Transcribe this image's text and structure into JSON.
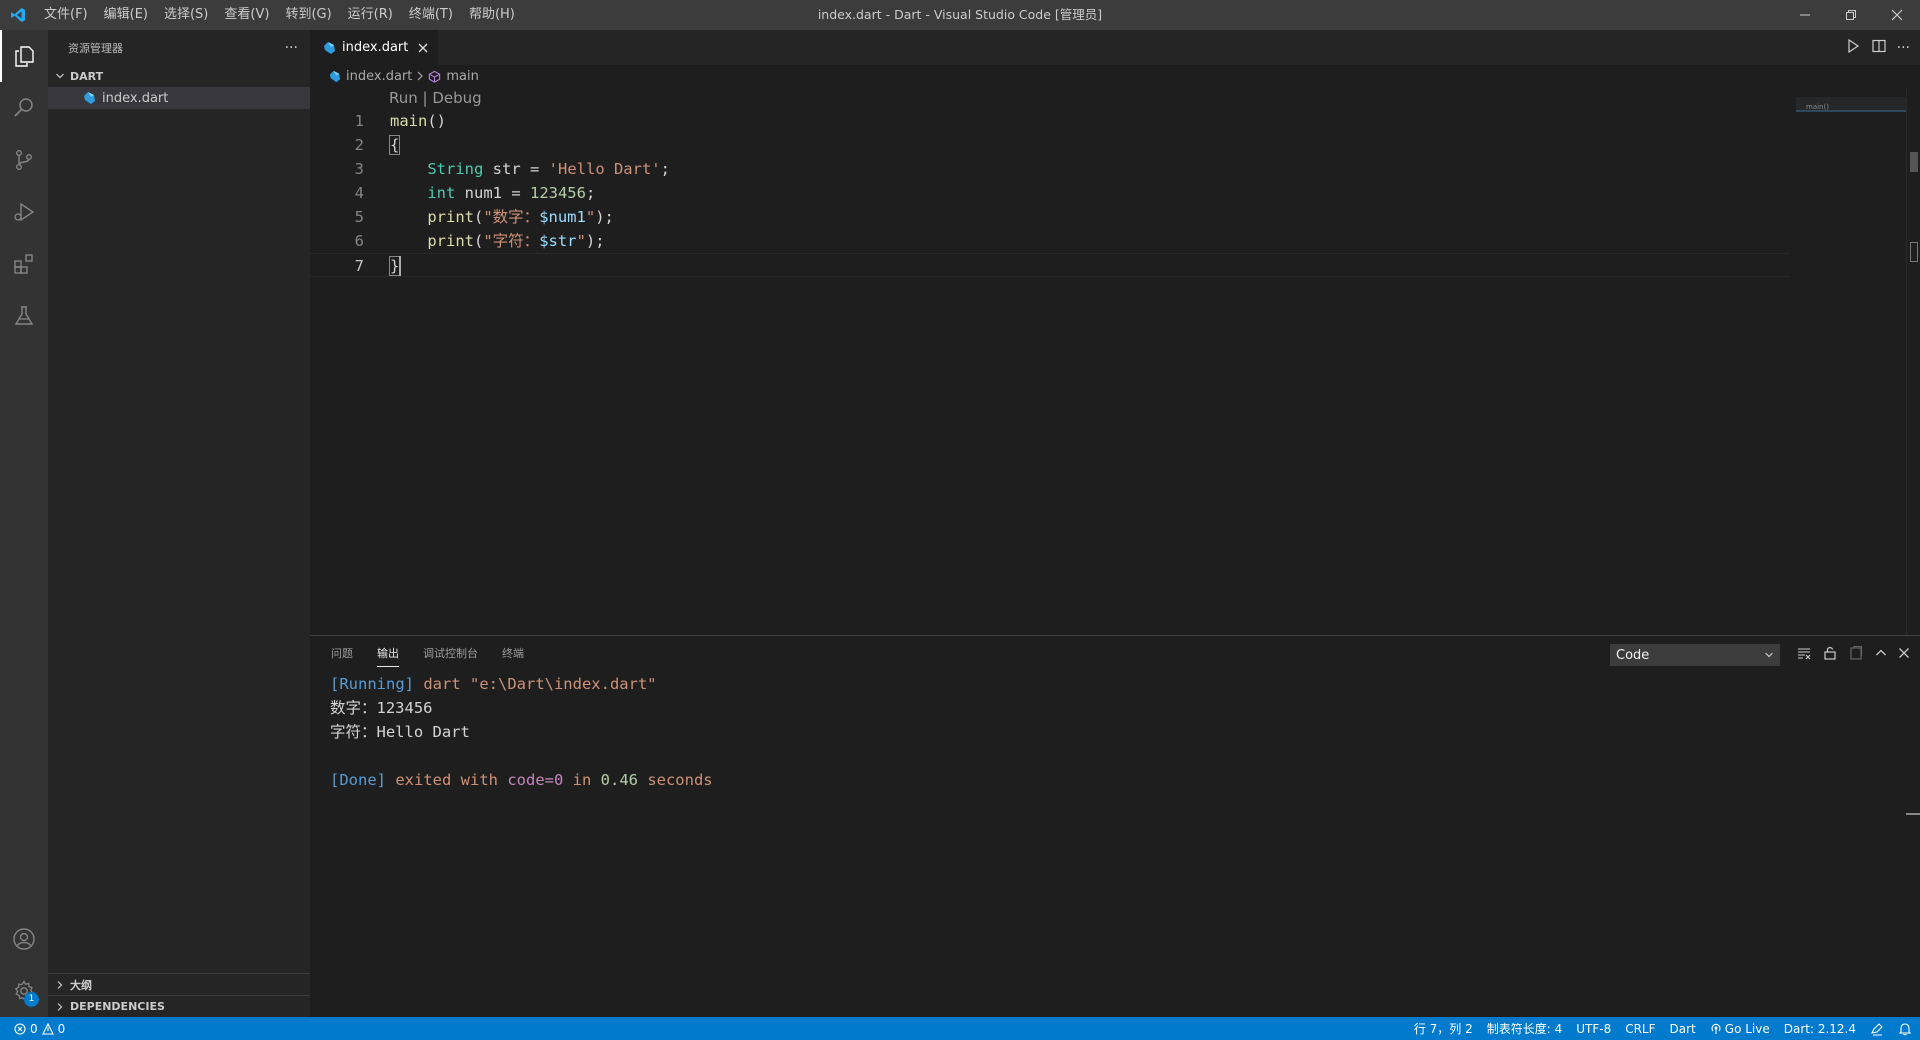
{
  "titlebar": {
    "menus": [
      "文件(F)",
      "编辑(E)",
      "选择(S)",
      "查看(V)",
      "转到(G)",
      "运行(R)",
      "终端(T)",
      "帮助(H)"
    ],
    "window_title": "index.dart - Dart - Visual Studio Code [管理员]"
  },
  "activitybar": {
    "icons": [
      "explorer-icon",
      "search-icon",
      "source-control-icon",
      "run-debug-icon",
      "extensions-icon",
      "testing-icon"
    ],
    "bottom_icons": [
      "account-icon",
      "settings-gear-icon"
    ],
    "settings_badge": "1"
  },
  "sidebar": {
    "title": "资源管理器",
    "more": "···",
    "folder": "DART",
    "files": [
      "index.dart"
    ],
    "outline": "大纲",
    "dependencies": "DEPENDENCIES"
  },
  "editor": {
    "tab_label": "index.dart",
    "breadcrumb_file": "index.dart",
    "breadcrumb_symbol": "main",
    "codelens": "Run | Debug",
    "line_numbers": [
      "1",
      "2",
      "3",
      "4",
      "5",
      "6",
      "7"
    ],
    "code": {
      "l1_fn": "main",
      "l1_rest": "()",
      "l2": "{",
      "l3_type": "String",
      "l3_mid": " str = ",
      "l3_str": "'Hello Dart'",
      "l3_end": ";",
      "l4_type": "int",
      "l4_mid": " num1 = ",
      "l4_num": "123456",
      "l4_end": ";",
      "l5_fn": "print",
      "l5_open": "(",
      "l5_str": "\"数字：",
      "l5_var": "$num1",
      "l5_strend": "\"",
      "l5_end": ");",
      "l6_fn": "print",
      "l6_open": "(",
      "l6_str": "\"字符：",
      "l6_var": "$str",
      "l6_strend": "\"",
      "l6_end": ");",
      "l7": "}"
    },
    "minimap_label": "main()"
  },
  "panel": {
    "tabs": [
      "问题",
      "输出",
      "调试控制台",
      "终端"
    ],
    "output_channel": "Code",
    "output": {
      "l1_running": "[Running]",
      "l1_cmd": " dart \"e:\\Dart\\index.dart\"",
      "l2": "数字：123456",
      "l3": "字符：Hello Dart",
      "l5_done": "[Done]",
      "l5_exit": " exited with ",
      "l5_code": "code=0",
      "l5_in": " in ",
      "l5_num": "0.46",
      "l5_sec": " seconds"
    }
  },
  "statusbar": {
    "errors": "0",
    "warnings": "0",
    "position": "行 7，列 2",
    "tab_size": "制表符长度: 4",
    "encoding": "UTF-8",
    "eol": "CRLF",
    "language": "Dart",
    "go_live": "Go Live",
    "dart_version": "Dart: 2.12.4"
  },
  "colors": {
    "accent": "#007acc",
    "titlebar": "#3c3c3c",
    "activitybar": "#333333",
    "sidebar": "#252526",
    "editor": "#1e1e1e"
  }
}
